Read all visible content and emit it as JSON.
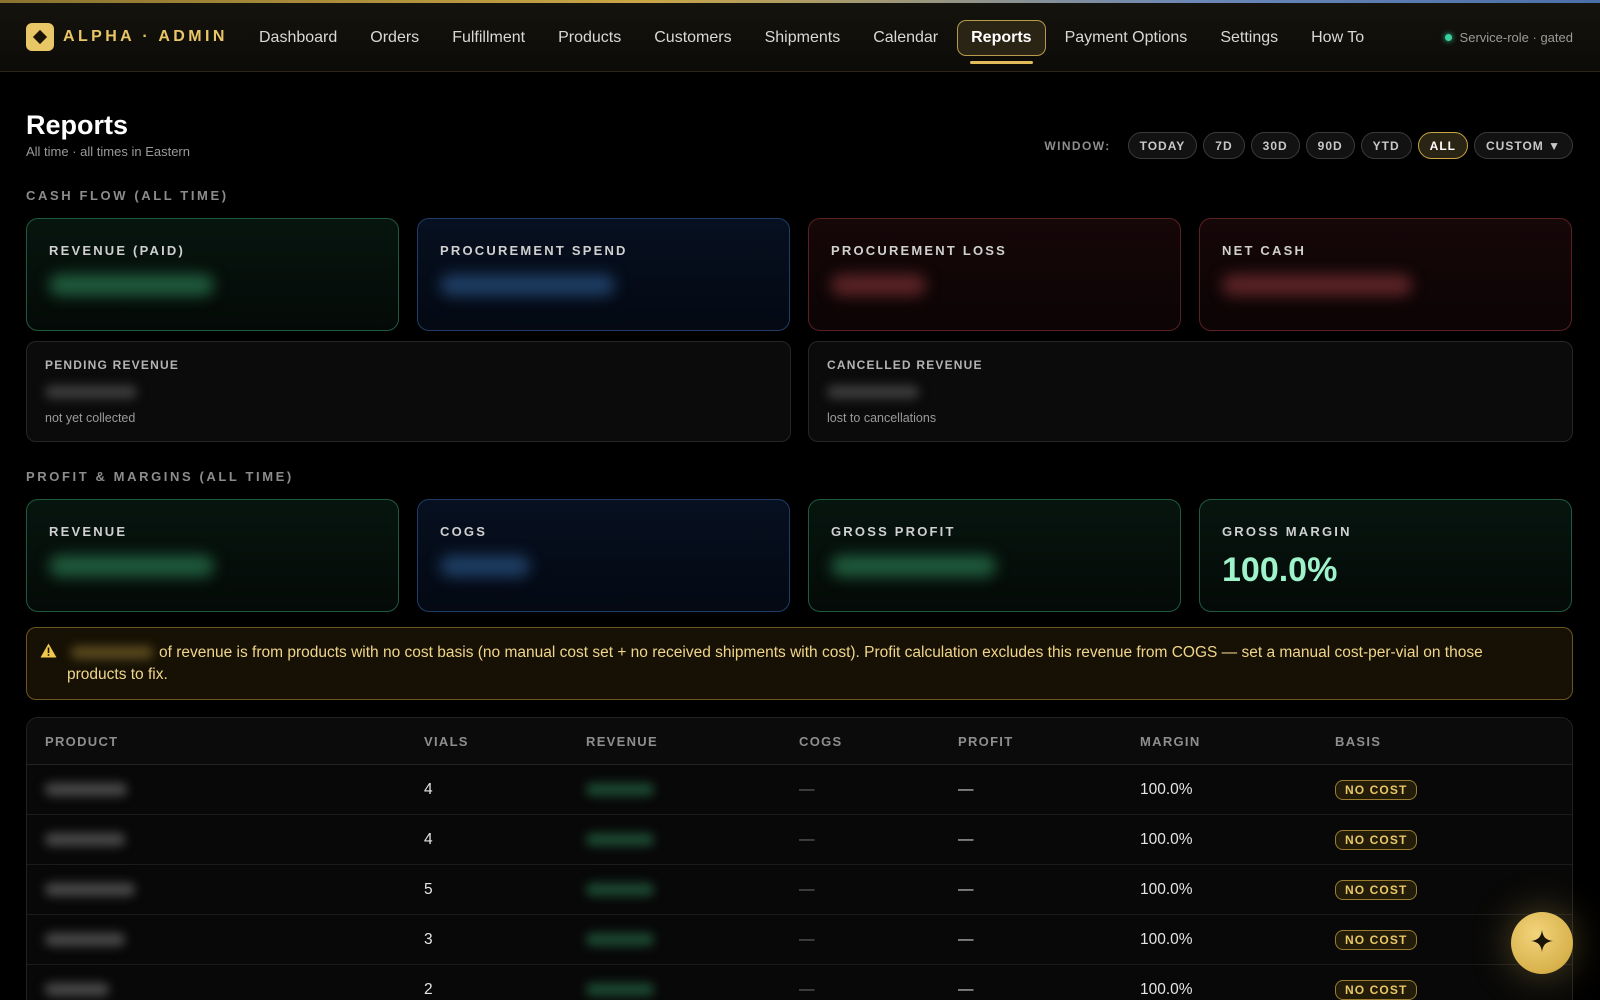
{
  "app": {
    "brand": "ALPHA · ADMIN",
    "status_text": "Service-role · gated",
    "accent_color": "#e9c766",
    "status_color": "#3ad29f"
  },
  "nav": {
    "items": [
      {
        "label": "Dashboard"
      },
      {
        "label": "Orders"
      },
      {
        "label": "Fulfillment"
      },
      {
        "label": "Products"
      },
      {
        "label": "Customers"
      },
      {
        "label": "Shipments"
      },
      {
        "label": "Calendar"
      },
      {
        "label": "Reports",
        "active": true
      },
      {
        "label": "Payment Options"
      },
      {
        "label": "Settings"
      },
      {
        "label": "How To"
      }
    ]
  },
  "header": {
    "title": "Reports",
    "subtitle": "All time · all times in Eastern",
    "window_label": "WINDOW:",
    "window_options": [
      "TODAY",
      "7D",
      "30D",
      "90D",
      "YTD",
      "ALL",
      "CUSTOM ▼"
    ],
    "window_selected": "ALL"
  },
  "cash_flow": {
    "title": "CASH FLOW (ALL TIME)",
    "cards": [
      {
        "label": "REVENUE (PAID)",
        "value_hidden": true
      },
      {
        "label": "PROCUREMENT SPEND",
        "value_hidden": true
      },
      {
        "label": "PROCUREMENT LOSS",
        "value_hidden": true
      },
      {
        "label": "NET CASH",
        "value_hidden": true
      }
    ],
    "pending": {
      "label": "PENDING REVENUE",
      "note": "not yet collected"
    },
    "cancelled": {
      "label": "CANCELLED REVENUE",
      "note": "lost to cancellations"
    }
  },
  "profit": {
    "title": "PROFIT & MARGINS (ALL TIME)",
    "cards": [
      {
        "label": "REVENUE",
        "value_hidden": true
      },
      {
        "label": "COGS",
        "value_hidden": true
      },
      {
        "label": "GROSS PROFIT",
        "value_hidden": true
      },
      {
        "label": "GROSS MARGIN",
        "value": "100.0%"
      }
    ]
  },
  "warning": {
    "icon": "warning-icon",
    "text": "of revenue is from products with no cost basis (no manual cost set + no received shipments with cost). Profit calculation excludes this revenue from COGS — set a manual cost-per-vial on those products to fix."
  },
  "table": {
    "headers": [
      "PRODUCT",
      "VIALS",
      "REVENUE",
      "COGS",
      "PROFIT",
      "MARGIN",
      "BASIS"
    ],
    "rows": [
      {
        "vials": "4",
        "cogs": "—",
        "profit": "—",
        "margin": "100.0%",
        "basis": "NO COST"
      },
      {
        "vials": "4",
        "cogs": "—",
        "profit": "—",
        "margin": "100.0%",
        "basis": "NO COST"
      },
      {
        "vials": "5",
        "cogs": "—",
        "profit": "—",
        "margin": "100.0%",
        "basis": "NO COST"
      },
      {
        "vials": "3",
        "cogs": "—",
        "profit": "—",
        "margin": "100.0%",
        "basis": "NO COST"
      },
      {
        "vials": "2",
        "cogs": "—",
        "profit": "—",
        "margin": "100.0%",
        "basis": "NO COST"
      }
    ]
  },
  "fab": {
    "icon": "sparkle-icon"
  }
}
